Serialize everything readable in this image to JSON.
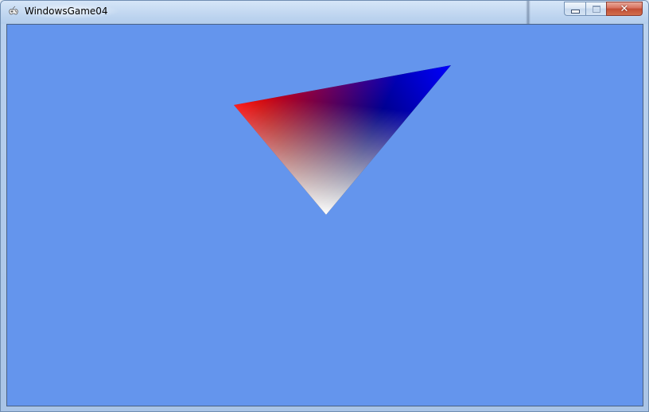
{
  "window": {
    "title": "WindowsGame04",
    "icon": "gamepad-icon",
    "buttons": {
      "minimize": "minimize-icon",
      "maximize": "maximize-icon",
      "close": "close-icon"
    }
  },
  "scene": {
    "clear_color": "#6495ed",
    "vertex_colors": {
      "left": "#ff0000",
      "right": "#0000ff",
      "bottom": "#ffffff"
    }
  }
}
